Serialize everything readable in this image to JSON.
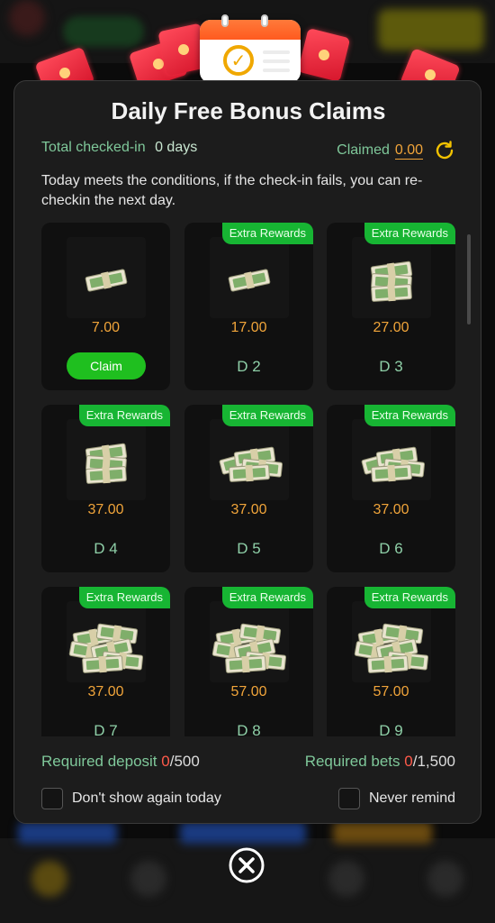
{
  "modal": {
    "title": "Daily Free Bonus Claims",
    "total_checked_label": "Total checked-in",
    "total_checked_value": "0 days",
    "claimed_label": "Claimed",
    "claimed_value": "0.00",
    "notice": "Today meets the conditions, if the check-in fails, you can re-checkin the next day.",
    "cards": [
      {
        "amount": "7.00",
        "badge": "",
        "day": "",
        "button": "Claim",
        "stack": 1
      },
      {
        "amount": "17.00",
        "badge": "Extra Rewards",
        "day": "D 2",
        "button": "",
        "stack": 1
      },
      {
        "amount": "27.00",
        "badge": "Extra Rewards",
        "day": "D 3",
        "button": "",
        "stack": 3
      },
      {
        "amount": "37.00",
        "badge": "Extra Rewards",
        "day": "D 4",
        "button": "",
        "stack": 3
      },
      {
        "amount": "37.00",
        "badge": "Extra Rewards",
        "day": "D 5",
        "button": "",
        "stack": 4
      },
      {
        "amount": "37.00",
        "badge": "Extra Rewards",
        "day": "D 6",
        "button": "",
        "stack": 4
      },
      {
        "amount": "37.00",
        "badge": "Extra Rewards",
        "day": "D 7",
        "button": "",
        "stack": 6
      },
      {
        "amount": "57.00",
        "badge": "Extra Rewards",
        "day": "D 8",
        "button": "",
        "stack": 6
      },
      {
        "amount": "57.00",
        "badge": "Extra Rewards",
        "day": "D 9",
        "button": "",
        "stack": 6
      }
    ],
    "required_deposit_label": "Required deposit",
    "required_deposit_current": "0",
    "required_deposit_total": "/500",
    "required_bets_label": "Required bets",
    "required_bets_current": "0",
    "required_bets_total": "/1,500",
    "dont_show_label": "Don't show again today",
    "never_remind_label": "Never remind"
  },
  "colors": {
    "accent_green": "#17b533",
    "amount_orange": "#f0a43a",
    "label_green": "#7fc89a",
    "required_red": "#ff5a4a"
  },
  "icons": {
    "refresh": "refresh-icon",
    "close": "close-circle-icon",
    "calendar": "calendar-check-icon"
  }
}
